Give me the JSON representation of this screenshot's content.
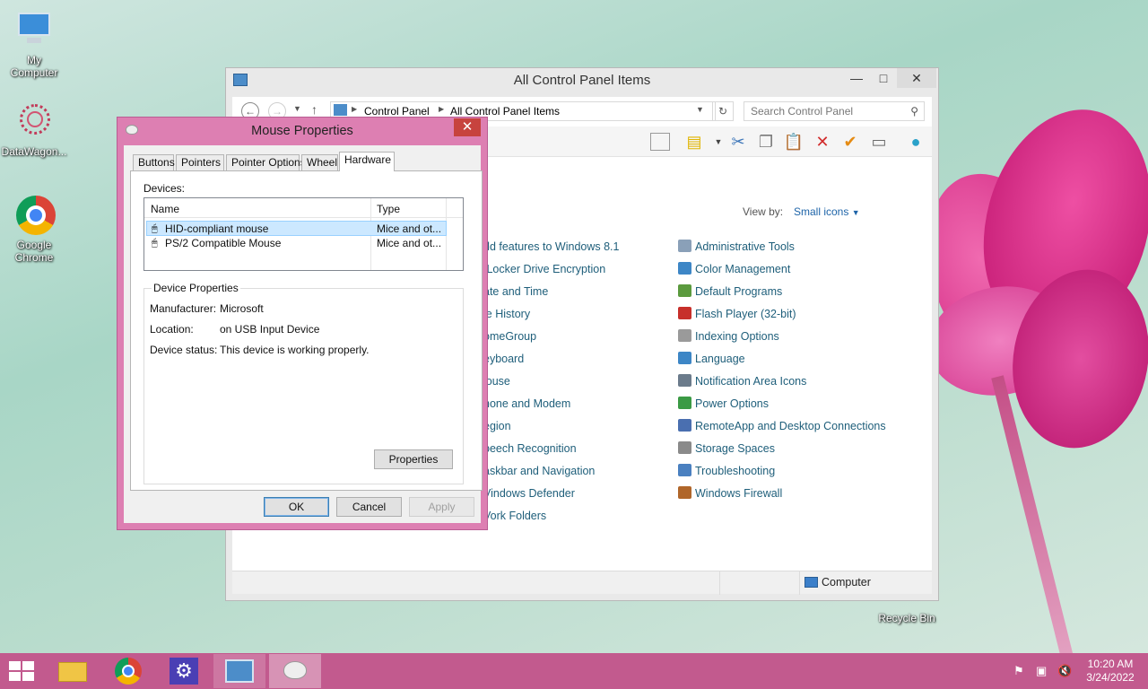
{
  "desktop": {
    "icons": [
      {
        "label_line1": "My",
        "label_line2": "Computer"
      },
      {
        "label_line1": "DataWagon...",
        "label_line2": ""
      },
      {
        "label_line1": "Google",
        "label_line2": "Chrome"
      },
      {
        "label_line1": "Recycle Bin",
        "label_line2": ""
      }
    ]
  },
  "control_panel": {
    "title": "All Control Panel Items",
    "breadcrumb": [
      "Control Panel",
      "All Control Panel Items"
    ],
    "search_placeholder": "Search Control Panel",
    "view_by_label": "View by:",
    "view_by_value": "Small icons",
    "left_items": [
      "dd features to Windows 8.1",
      "tLocker Drive Encryption",
      "ate and Time",
      "le History",
      "omeGroup",
      "eyboard",
      "louse",
      "hone and Modem",
      "egion",
      "peech Recognition",
      "askbar and Navigation",
      "Vindows Defender",
      "Vork Folders"
    ],
    "right_items": [
      "Administrative Tools",
      "Color Management",
      "Default Programs",
      "Flash Player (32-bit)",
      "Indexing Options",
      "Language",
      "Notification Area Icons",
      "Power Options",
      "RemoteApp and Desktop Connections",
      "Storage Spaces",
      "Troubleshooting",
      "Windows Firewall"
    ],
    "status_computer": "Computer"
  },
  "mouse_dialog": {
    "title": "Mouse Properties",
    "tabs": [
      "Buttons",
      "Pointers",
      "Pointer Options",
      "Wheel",
      "Hardware"
    ],
    "active_tab": "Hardware",
    "devices_label": "Devices:",
    "columns": [
      "Name",
      "Type"
    ],
    "devices": [
      {
        "name": "HID-compliant mouse",
        "type": "Mice and ot..."
      },
      {
        "name": "PS/2 Compatible Mouse",
        "type": "Mice and ot..."
      }
    ],
    "device_properties_label": "Device Properties",
    "manufacturer_label": "Manufacturer:",
    "manufacturer": "Microsoft",
    "location_label": "Location:",
    "location": "on USB Input Device",
    "status_label": "Device status:",
    "status": "This device is working properly.",
    "properties_button": "Properties",
    "ok_button": "OK",
    "cancel_button": "Cancel",
    "apply_button": "Apply"
  },
  "taskbar": {
    "clock_time": "10:20 AM",
    "clock_date": "3/24/2022"
  }
}
